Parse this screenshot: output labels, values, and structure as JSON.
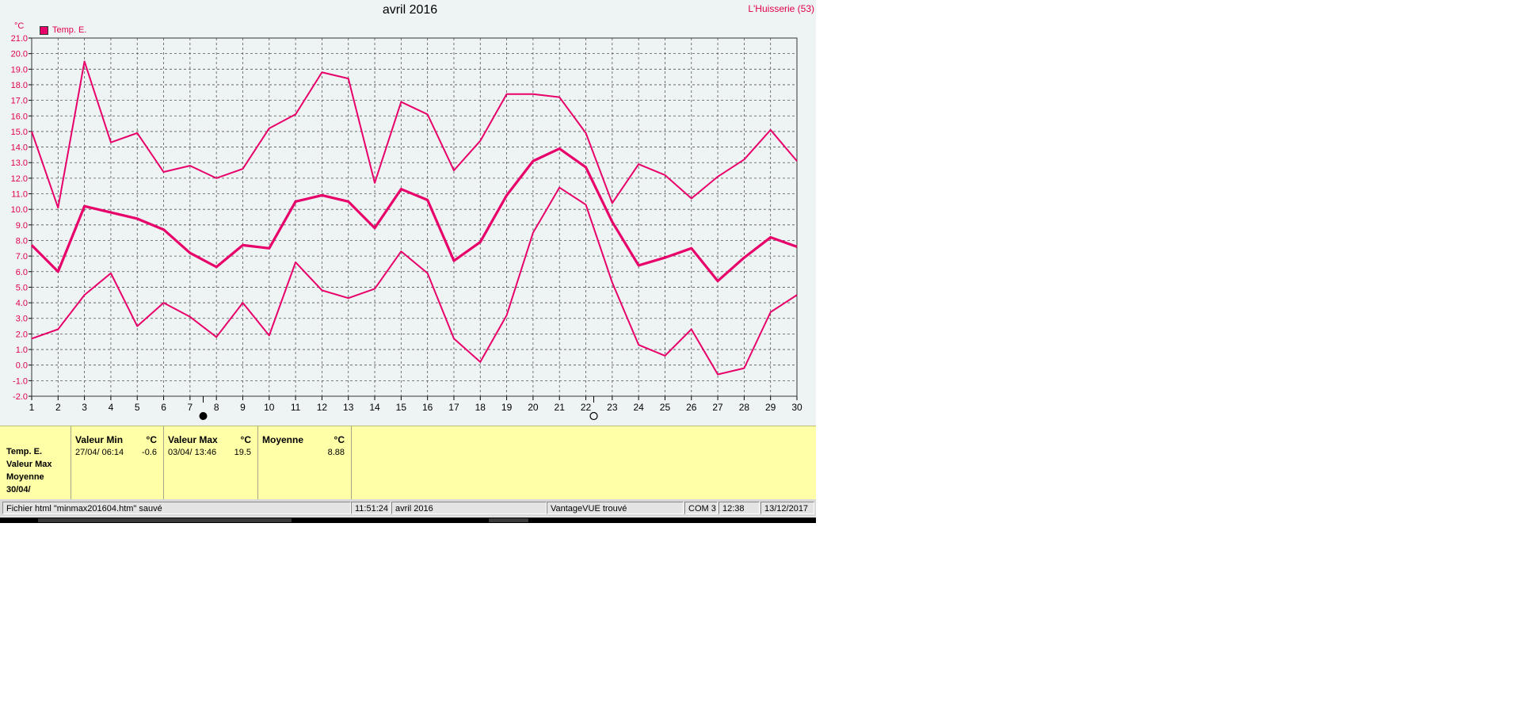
{
  "chart_data": {
    "type": "line",
    "title": "avril 2016",
    "station": "L'Huisserie (53)",
    "ylabel": "°C",
    "ylim": [
      -2.0,
      21.0
    ],
    "y_ticks": [
      "21.0",
      "20.0",
      "19.0",
      "18.0",
      "17.0",
      "16.0",
      "15.0",
      "14.0",
      "13.0",
      "12.0",
      "11.0",
      "10.0",
      "9.0",
      "8.0",
      "7.0",
      "6.0",
      "5.0",
      "4.0",
      "3.0",
      "2.0",
      "1.0",
      "0.0",
      "-1.0",
      "-2.0"
    ],
    "x": [
      1,
      2,
      3,
      4,
      5,
      6,
      7,
      8,
      9,
      10,
      11,
      12,
      13,
      14,
      15,
      16,
      17,
      18,
      19,
      20,
      21,
      22,
      23,
      24,
      25,
      26,
      27,
      28,
      29,
      30
    ],
    "legend": "Temp. E.",
    "series": [
      {
        "role": "max",
        "values": [
          15.0,
          10.1,
          19.5,
          14.3,
          14.9,
          12.4,
          12.8,
          12.0,
          12.6,
          15.2,
          16.1,
          18.8,
          18.4,
          11.7,
          16.9,
          16.1,
          12.5,
          14.4,
          17.4,
          17.4,
          17.2,
          14.9,
          10.4,
          12.9,
          12.2,
          10.7,
          12.1,
          13.2,
          15.1,
          13.1
        ]
      },
      {
        "role": "mean",
        "values": [
          7.7,
          6.0,
          10.2,
          9.8,
          9.4,
          8.7,
          7.2,
          6.3,
          7.7,
          7.5,
          10.5,
          10.9,
          10.5,
          8.8,
          11.3,
          10.6,
          6.7,
          7.9,
          10.9,
          13.1,
          13.9,
          12.7,
          9.2,
          6.4,
          6.9,
          7.5,
          5.4,
          6.9,
          8.2,
          7.6
        ]
      },
      {
        "role": "min",
        "values": [
          1.7,
          2.3,
          4.5,
          5.9,
          2.5,
          4.0,
          3.1,
          1.8,
          4.0,
          1.9,
          6.6,
          4.8,
          4.3,
          4.9,
          7.3,
          5.9,
          1.7,
          0.2,
          3.2,
          8.5,
          11.4,
          10.3,
          5.3,
          1.3,
          0.6,
          2.3,
          -0.6,
          -0.2,
          3.4,
          4.5
        ]
      }
    ],
    "markers": [
      {
        "x": 7.5,
        "symbol": "new-moon"
      },
      {
        "x": 22.3,
        "symbol": "full-moon"
      }
    ],
    "colors": {
      "line": "#e8006a",
      "grid": "#555555",
      "bg": "#eef4f4"
    }
  },
  "stats": {
    "labels": [
      "Temp. E.",
      "Valeur Max",
      "Moyenne",
      "30/04/"
    ],
    "min": {
      "header": "Valeur Min",
      "unit": "°C",
      "date": "27/04/  06:14",
      "value": "-0.6"
    },
    "max": {
      "header": "Valeur Max",
      "unit": "°C",
      "date": "03/04/  13:46",
      "value": "19.5"
    },
    "avg": {
      "header": "Moyenne",
      "unit": "°C",
      "value": "8.88"
    }
  },
  "status_bar": {
    "message": "Fichier html  \"minmax201604.htm\"  sauvé",
    "time": "11:51:24",
    "period": "avril 2016",
    "console": "VantageVUE trouvé",
    "port": "COM 3",
    "clock": "12:38",
    "date": "13/12/2017"
  }
}
